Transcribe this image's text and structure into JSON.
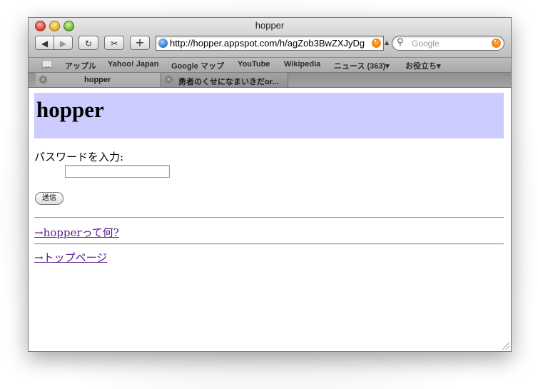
{
  "window": {
    "title": "hopper"
  },
  "toolbar": {
    "back_icon": "back-arrow-icon",
    "forward_icon": "forward-arrow-icon",
    "reload_icon": "reload-icon",
    "snapback_icon": "snapback-icon",
    "add_bookmark_label": "+",
    "url": "http://hopper.appspot.com/h/agZob3BwZXJyDg",
    "search_placeholder": "Google"
  },
  "bookmarks": [
    {
      "label": "アップル"
    },
    {
      "label": "Yahoo! Japan"
    },
    {
      "label": "Google マップ"
    },
    {
      "label": "YouTube"
    },
    {
      "label": "Wikipedia"
    },
    {
      "label": "ニュース (363)▾"
    },
    {
      "label": "お役立ち▾"
    }
  ],
  "tabs": [
    {
      "title": "hopper",
      "active": true
    },
    {
      "title": "勇者のくせになまいきだor...",
      "active": false
    }
  ],
  "page": {
    "site_title": "hopper",
    "password_label": "パスワードを入力:",
    "password_value": "",
    "submit_label": "送信",
    "links": [
      {
        "label": "→hopperって何?"
      },
      {
        "label": "→トップページ"
      }
    ],
    "header_color": "#ccccff",
    "link_color": "#551a8b"
  }
}
